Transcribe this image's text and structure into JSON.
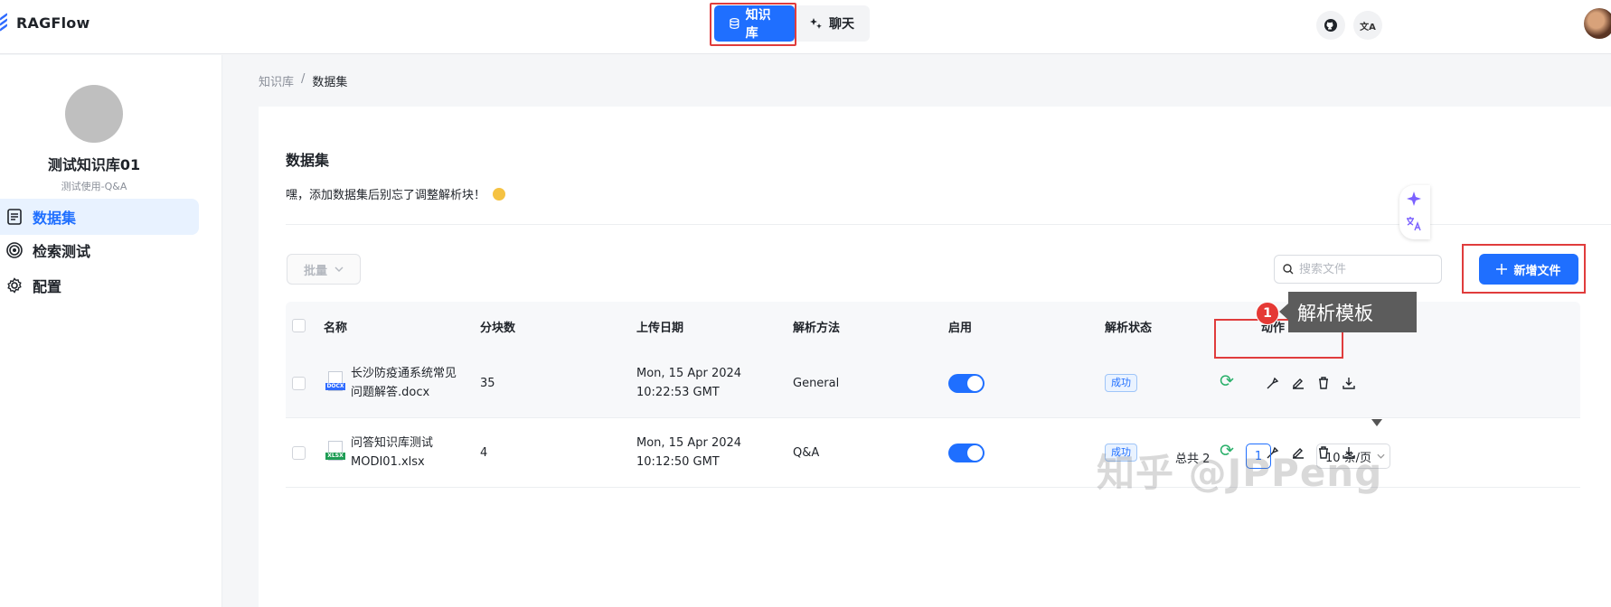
{
  "app": {
    "name": "RAGFlow"
  },
  "nav": {
    "tabs": [
      {
        "label": "知识库"
      },
      {
        "label": "聊天"
      }
    ]
  },
  "header": {
    "translate_label": "文A"
  },
  "sidebar": {
    "kb_name": "测试知识库01",
    "kb_desc": "测试使用-Q&A",
    "items": [
      {
        "label": "数据集"
      },
      {
        "label": "检索测试"
      },
      {
        "label": "配置"
      }
    ]
  },
  "breadcrumb": {
    "root": "知识库",
    "sep": "/",
    "current": "数据集"
  },
  "main": {
    "title": "数据集",
    "tip": "嘿，添加数据集后别忘了调整解析块！",
    "bulk_label": "批量",
    "search_placeholder": "搜索文件",
    "add_label": "新增文件",
    "columns": [
      "名称",
      "分块数",
      "上传日期",
      "解析方法",
      "启用",
      "解析状态",
      "动作"
    ],
    "rows": [
      {
        "name_line1": "长沙防疫通系统常见",
        "name_line2": "问题解答.docx",
        "file_type": "DOCX",
        "chunks": "35",
        "date_line1": "Mon, 15 Apr 2024",
        "date_line2": "10:22:53 GMT",
        "method": "General",
        "enabled": true,
        "status": "成功"
      },
      {
        "name_line1": "问答知识库测试",
        "name_line2": "MODI01.xlsx",
        "file_type": "XLSX",
        "chunks": "4",
        "date_line1": "Mon, 15 Apr 2024",
        "date_line2": "10:12:50 GMT",
        "method": "Q&A",
        "enabled": true,
        "status": "成功"
      }
    ],
    "tooltip": "解析模板",
    "callout_number": "1",
    "pager": {
      "total": "总共 2",
      "page": "1",
      "page_size": "10 条/页"
    }
  },
  "watermark": "知乎 @JPPeng",
  "colors": {
    "primary": "#1f6fff",
    "success": "#2ab06a",
    "highlight": "#e03c3c"
  }
}
